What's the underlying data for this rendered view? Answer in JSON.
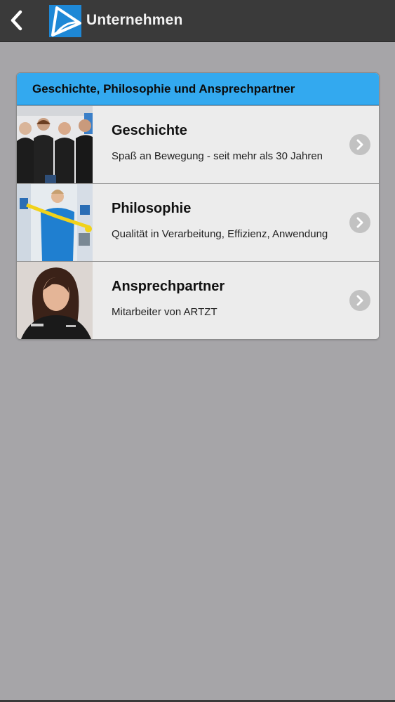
{
  "header": {
    "title": "Unternehmen",
    "back_icon": "chevron-left-icon",
    "logo_icon": "artzt-logo"
  },
  "panel": {
    "title": "Geschichte, Philosophie und Ansprechpartner",
    "accent_color": "#33a9ef",
    "items": [
      {
        "title": "Geschichte",
        "subtitle": "Spaß an Bewegung - seit mehr als 30 Jahren",
        "thumb": "team-photo"
      },
      {
        "title": "Philosophie",
        "subtitle": "Qualität in Verarbeitung, Effizienz, Anwendung",
        "thumb": "trainer-photo"
      },
      {
        "title": "Ansprechpartner",
        "subtitle": "Mitarbeiter von ARTZT",
        "thumb": "contact-photo"
      }
    ]
  }
}
